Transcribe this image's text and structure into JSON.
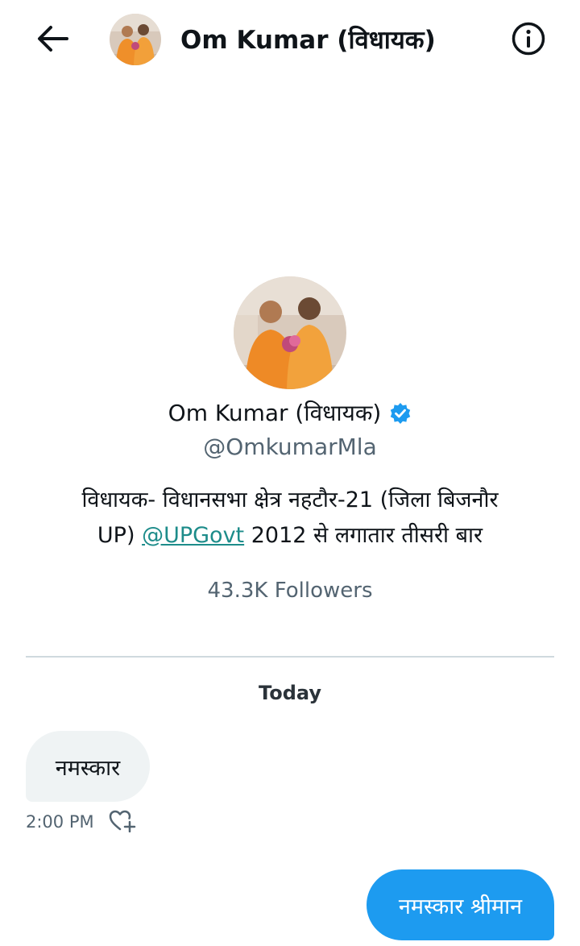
{
  "header": {
    "title": "Om Kumar (विधायक)",
    "back_icon": "arrow-left-icon",
    "info_icon": "info-icon"
  },
  "profile": {
    "name": "Om Kumar (विधायक)",
    "verified_icon": "verified-badge-icon",
    "handle": "@OmkumarMla",
    "bio_line1": "विधायक- विधानसभा क्षेत्र नहटौर-21 (जिला बिजनौर",
    "bio_line2_pre": "UP) ",
    "bio_link": "@UPGovt",
    "bio_line2_post": " 2012 से लगातार तीसरी बार",
    "followers": "43.3K Followers"
  },
  "conversation": {
    "date_label": "Today",
    "messages": [
      {
        "direction": "received",
        "text": "नमस्कार",
        "time": "2:00 PM",
        "reaction_icon": "heart-add-icon"
      },
      {
        "direction": "sent",
        "text": "नमस्कार श्रीमान"
      }
    ]
  },
  "colors": {
    "accent": "#1d9bf0",
    "link": "#1d8c8a",
    "muted": "#536471",
    "bubble_received": "#eff3f4",
    "verified": "#1d9bf0"
  }
}
